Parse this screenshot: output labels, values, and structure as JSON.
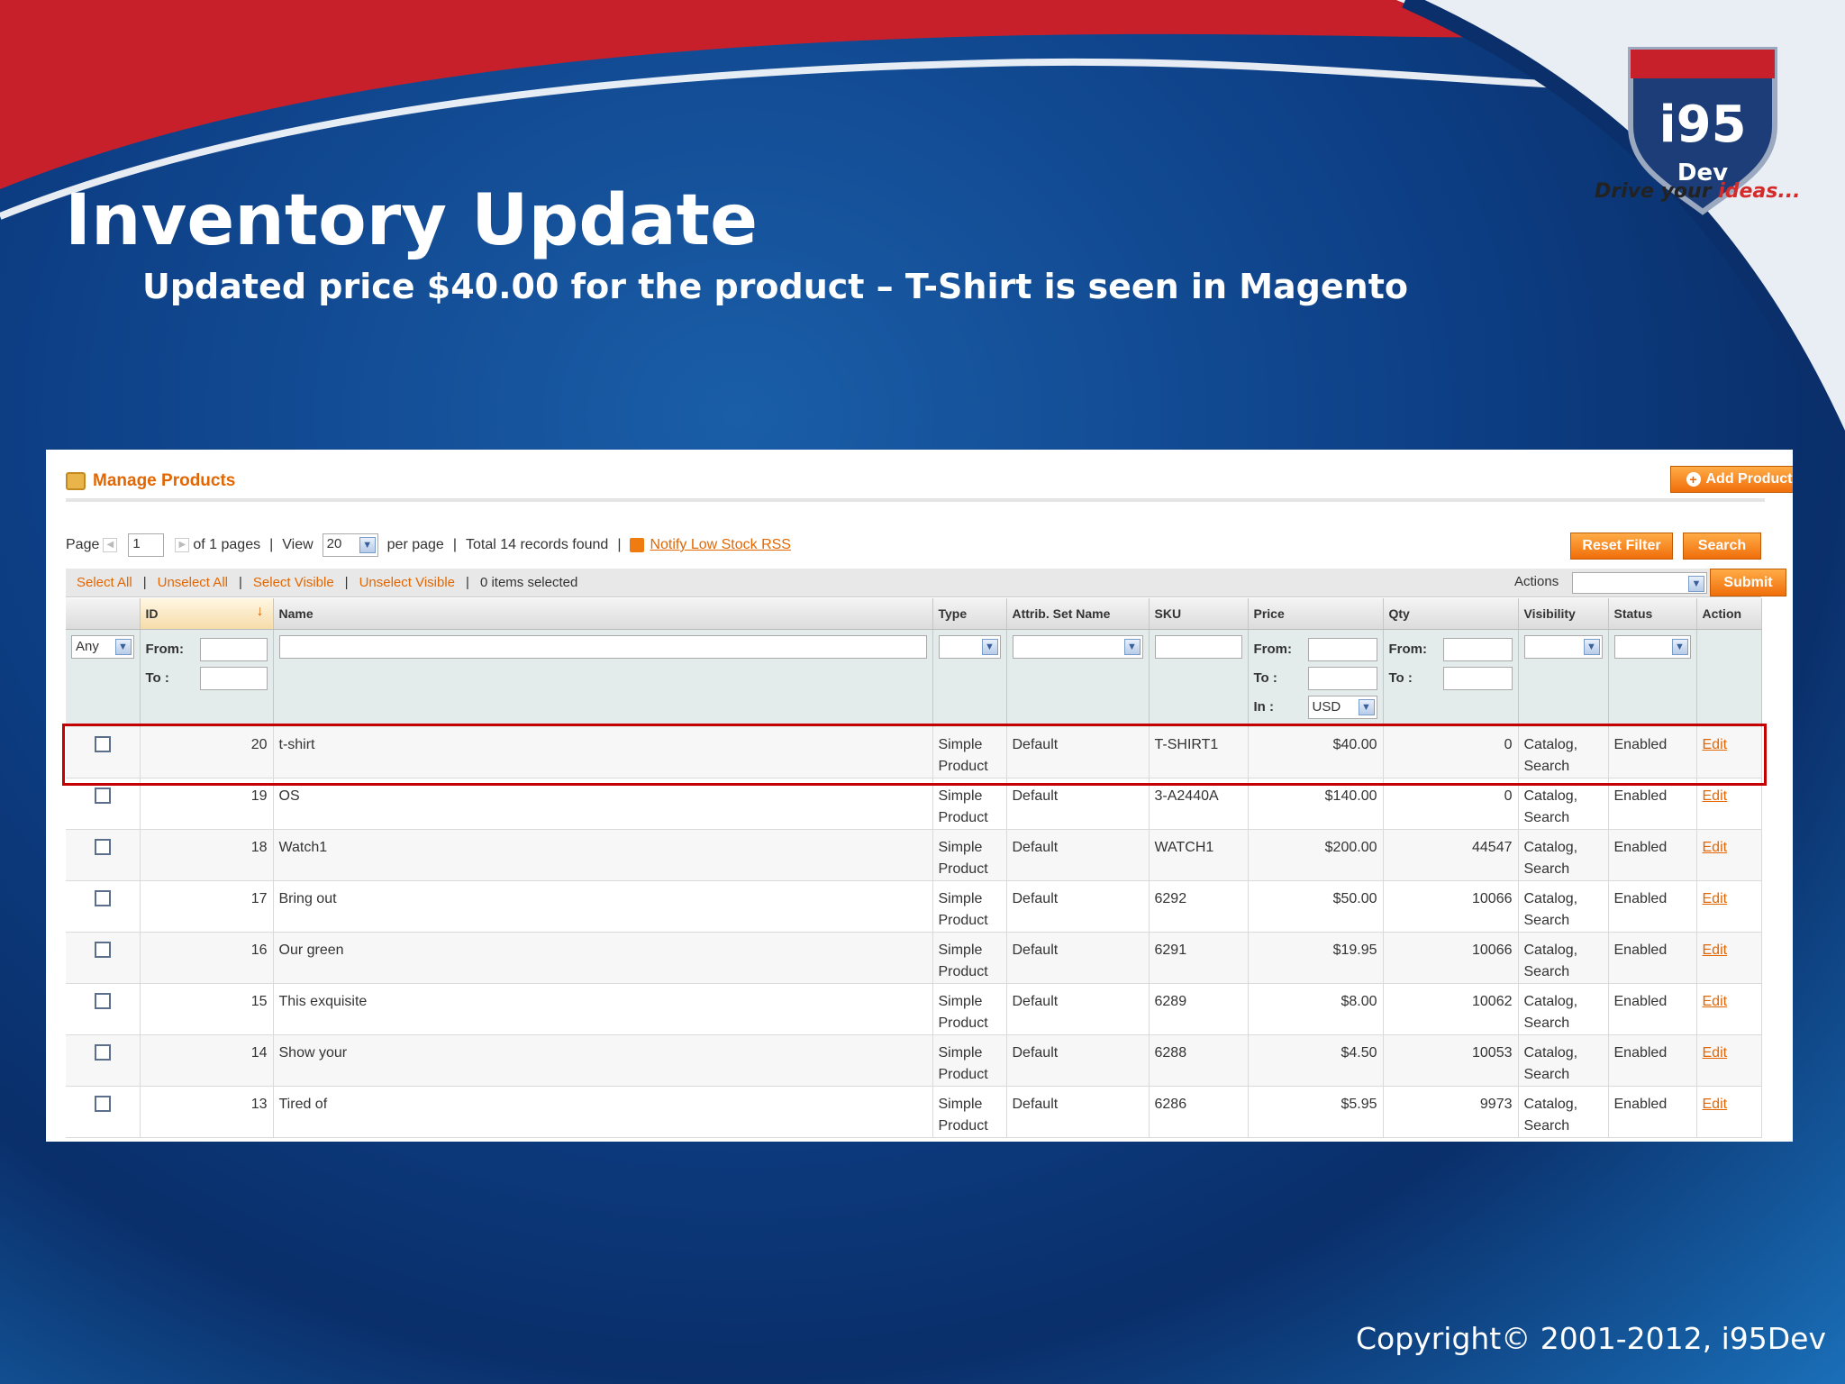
{
  "slide": {
    "title": "Inventory Update",
    "subtitle": "Updated price $40.00 for the product – T-Shirt is seen in Magento",
    "logo_text": "i95",
    "logo_sub": "Dev",
    "tagline_a": "Drive your ",
    "tagline_b": "ideas...",
    "copyright": "Copyright© 2001-2012, i95Dev"
  },
  "panel": {
    "title": "Manage Products",
    "add_button": "Add Product",
    "pager": {
      "page_label": "Page",
      "page_value": "1",
      "of_pages": "of 1 pages",
      "view_label": "View",
      "view_value": "20",
      "per_page": "per page",
      "total": "Total 14 records found",
      "rss": "Notify Low Stock RSS"
    },
    "reset_button": "Reset Filter",
    "search_button": "Search",
    "mass": {
      "select_all": "Select All",
      "unselect_all": "Unselect All",
      "select_visible": "Select Visible",
      "unselect_visible": "Unselect Visible",
      "selected": "0 items selected",
      "actions_label": "Actions",
      "submit": "Submit"
    },
    "columns": [
      "ID",
      "Name",
      "Type",
      "Attrib. Set Name",
      "SKU",
      "Price",
      "Qty",
      "Visibility",
      "Status",
      "Action"
    ],
    "filter": {
      "any": "Any",
      "from": "From:",
      "to": "To :",
      "in": "In :",
      "currency": "USD"
    },
    "rows": [
      {
        "id": "20",
        "name": "t-shirt",
        "type_a": "Simple",
        "type_b": "Product",
        "attr": "Default",
        "sku": "T-SHIRT1",
        "price": "$40.00",
        "qty": "0",
        "vis_a": "Catalog,",
        "vis_b": "Search",
        "status": "Enabled",
        "action": "Edit"
      },
      {
        "id": "19",
        "name": "OS",
        "type_a": "Simple",
        "type_b": "Product",
        "attr": "Default",
        "sku": "3-A2440A",
        "price": "$140.00",
        "qty": "0",
        "vis_a": "Catalog,",
        "vis_b": "Search",
        "status": "Enabled",
        "action": "Edit"
      },
      {
        "id": "18",
        "name": "Watch1",
        "type_a": "Simple",
        "type_b": "Product",
        "attr": "Default",
        "sku": "WATCH1",
        "price": "$200.00",
        "qty": "44547",
        "vis_a": "Catalog,",
        "vis_b": "Search",
        "status": "Enabled",
        "action": "Edit"
      },
      {
        "id": "17",
        "name": "Bring out",
        "type_a": "Simple",
        "type_b": "Product",
        "attr": "Default",
        "sku": "6292",
        "price": "$50.00",
        "qty": "10066",
        "vis_a": "Catalog,",
        "vis_b": "Search",
        "status": "Enabled",
        "action": "Edit"
      },
      {
        "id": "16",
        "name": "Our green",
        "type_a": "Simple",
        "type_b": "Product",
        "attr": "Default",
        "sku": "6291",
        "price": "$19.95",
        "qty": "10066",
        "vis_a": "Catalog,",
        "vis_b": "Search",
        "status": "Enabled",
        "action": "Edit"
      },
      {
        "id": "15",
        "name": "This exquisite",
        "type_a": "Simple",
        "type_b": "Product",
        "attr": "Default",
        "sku": "6289",
        "price": "$8.00",
        "qty": "10062",
        "vis_a": "Catalog,",
        "vis_b": "Search",
        "status": "Enabled",
        "action": "Edit"
      },
      {
        "id": "14",
        "name": "Show your",
        "type_a": "Simple",
        "type_b": "Product",
        "attr": "Default",
        "sku": "6288",
        "price": "$4.50",
        "qty": "10053",
        "vis_a": "Catalog,",
        "vis_b": "Search",
        "status": "Enabled",
        "action": "Edit"
      },
      {
        "id": "13",
        "name": "Tired of",
        "type_a": "Simple",
        "type_b": "Product",
        "attr": "Default",
        "sku": "6286",
        "price": "$5.95",
        "qty": "9973",
        "vis_a": "Catalog,",
        "vis_b": "Search",
        "status": "Enabled",
        "action": "Edit"
      }
    ]
  },
  "colors": {
    "accent": "#e26703",
    "highlight": "#c40000",
    "slide_blue": "#0d3f86"
  }
}
